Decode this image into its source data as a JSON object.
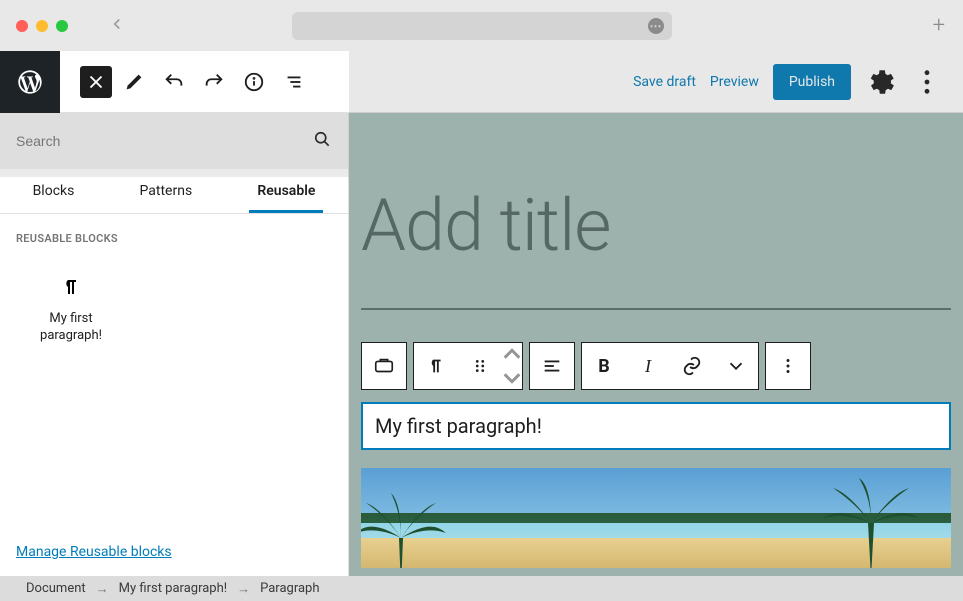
{
  "toolbar": {
    "save_draft": "Save draft",
    "preview": "Preview",
    "publish": "Publish"
  },
  "inserter": {
    "search_placeholder": "Search",
    "tabs": [
      "Blocks",
      "Patterns",
      "Reusable"
    ],
    "active_tab_index": 2,
    "section_title": "REUSABLE BLOCKS",
    "block_item_label": "My first paragraph!",
    "manage_link": "Manage Reusable blocks"
  },
  "canvas": {
    "title_placeholder": "Add title",
    "paragraph_text": "My first paragraph!",
    "format_bold": "B",
    "format_italic": "I"
  },
  "breadcrumb": {
    "items": [
      "Document",
      "My first paragraph!",
      "Paragraph"
    ]
  }
}
